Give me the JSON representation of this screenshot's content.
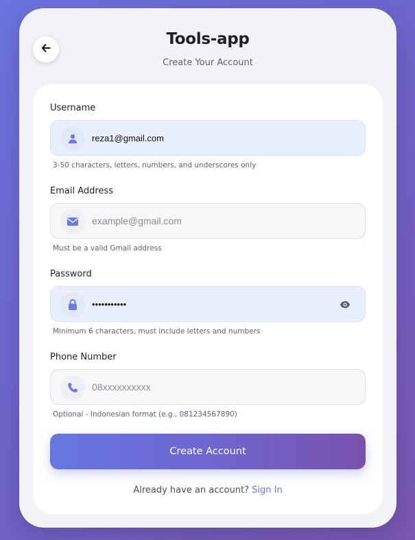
{
  "header": {
    "title": "Tools-app",
    "subtitle": "Create Your Account"
  },
  "form": {
    "username": {
      "label": "Username",
      "value": "reza1@gmail.com",
      "placeholder": "",
      "hint": "3-50 characters, letters, numbers, and underscores only",
      "icon": "user-icon"
    },
    "email": {
      "label": "Email Address",
      "value": "",
      "placeholder": "example@gmail.com",
      "hint": "Must be a valid Gmail address",
      "icon": "envelope-icon"
    },
    "password": {
      "label": "Password",
      "value": "•••••••••••",
      "placeholder": "",
      "hint": "Minimum 6 characters, must include letters and numbers",
      "icon": "lock-icon",
      "toggle_icon": "eye-icon"
    },
    "phone": {
      "label": "Phone Number",
      "value": "",
      "placeholder": "08xxxxxxxxxx",
      "hint": "Optional - Indonesian format (e.g., 081234567890)",
      "icon": "phone-icon"
    },
    "submit_label": "Create Account"
  },
  "footer": {
    "prompt": "Already have an account?",
    "link_label": "Sign In"
  },
  "colors": {
    "accent": "#6776e2",
    "accent_end": "#7852ad",
    "link": "#5f7be6",
    "icon": "#6b7be0"
  }
}
